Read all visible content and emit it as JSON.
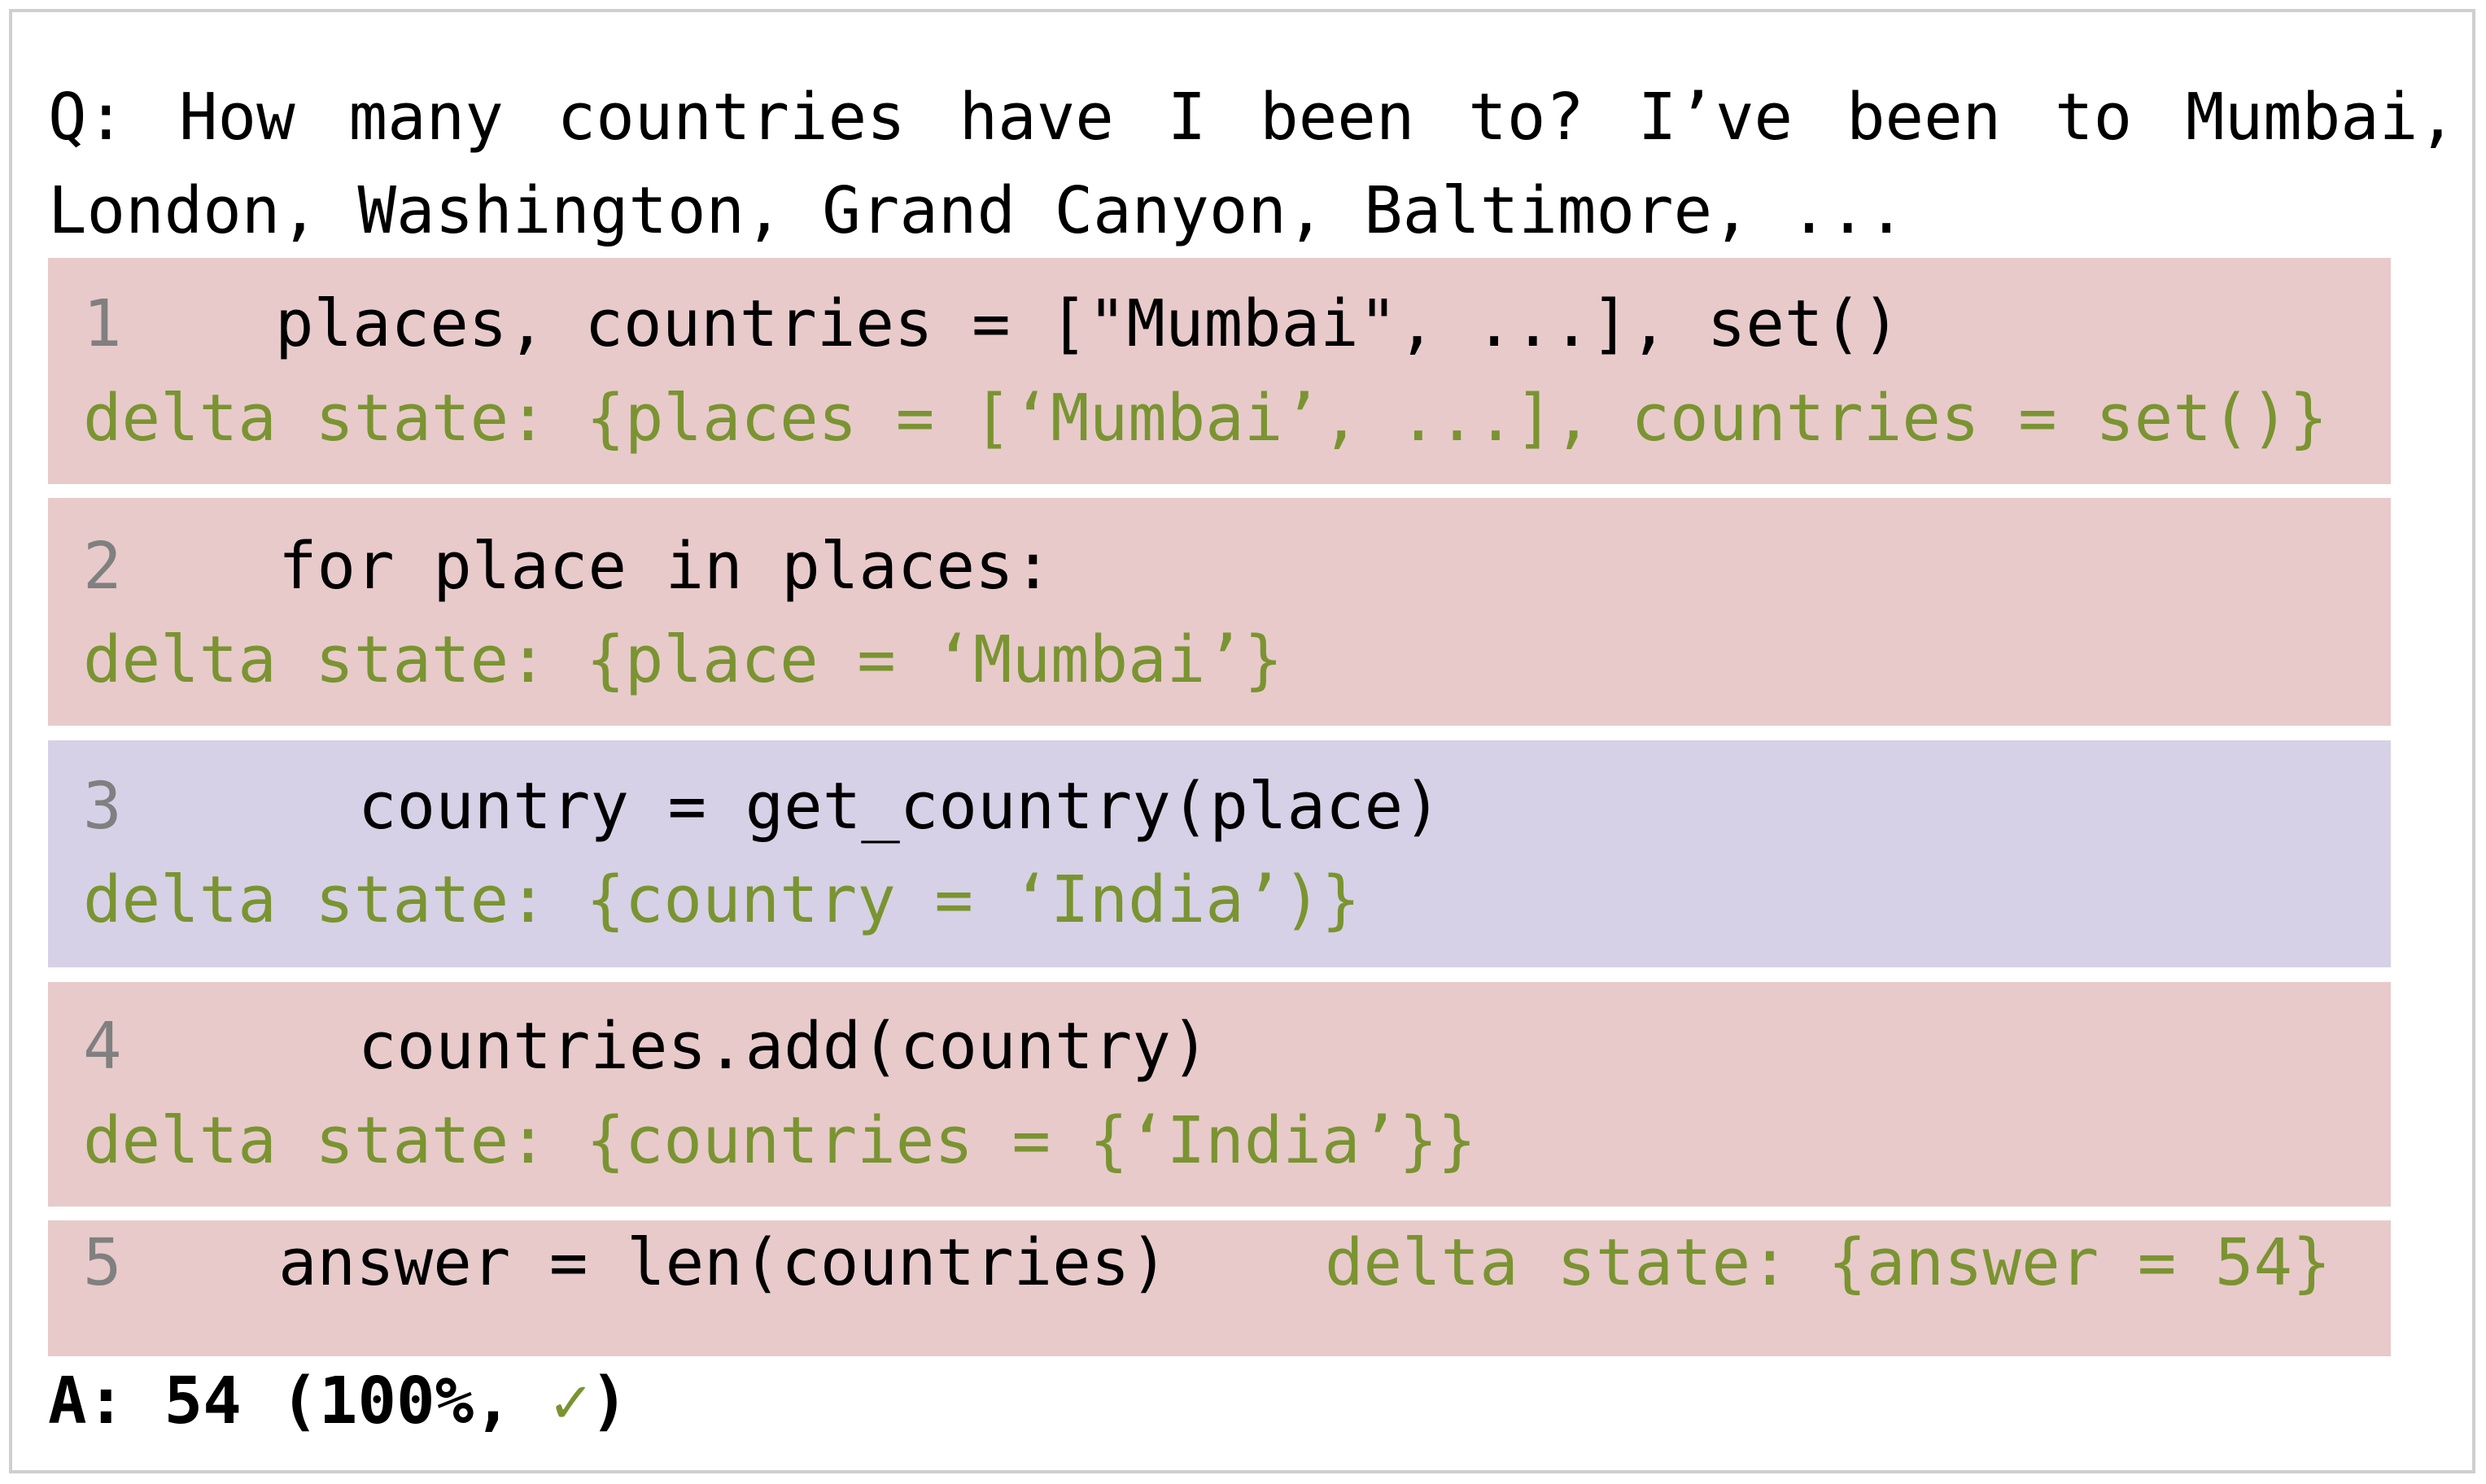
{
  "question": {
    "line1": "Q: How many countries have I been to?  I’ve been to Mumbai,",
    "line2": "London, Washington, Grand Canyon, Baltimore, ..."
  },
  "steps": [
    {
      "num": "1",
      "code": "places, countries = [\"Mumbai\", ...], set()",
      "delta": "delta state: {places = [‘Mumbai’, ...], countries = set()}",
      "active": false
    },
    {
      "num": "2",
      "code": "for place in places:",
      "delta": "delta state: {place = ‘Mumbai’}",
      "active": false
    },
    {
      "num": "3",
      "code": "country = get_country(place)",
      "delta": "delta state: {country = ‘India’)}",
      "active": true
    },
    {
      "num": "4",
      "code": "countries.add(country)",
      "delta": "delta state: {countries = {‘India’}}",
      "active": false
    },
    {
      "num": "5",
      "code": "answer = len(countries)",
      "delta": "delta state: {answer = 54}",
      "active": false
    }
  ],
  "answer": {
    "prefix": "A: 54 (100%, ",
    "check_icon": "✓",
    "suffix": ")"
  },
  "colors": {
    "step_bg": "#e8cacb",
    "active_step_bg": "#d6d1e6",
    "delta_text": "#7a9431",
    "line_number": "#808080"
  }
}
